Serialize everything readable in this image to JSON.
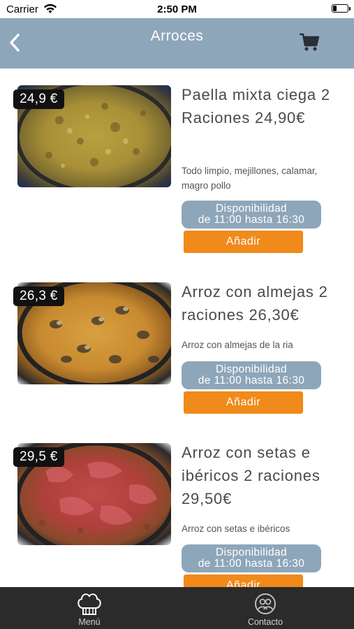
{
  "status_bar": {
    "carrier": "Carrier",
    "time": "2:50 PM"
  },
  "nav": {
    "title": "Arroces",
    "back_icon": "chevron-left-icon",
    "cart_icon": "shopping-cart-icon"
  },
  "items": [
    {
      "price_tag": "24,9 €",
      "name": "Paella mixta ciega 2 Raciones 24,90€",
      "description": "Todo limpio, mejillones, calamar, magro pollo",
      "availability_line1": "Disponibilidad",
      "availability_line2": "de 11:00 hasta 16:30",
      "add_label": "Añadir"
    },
    {
      "price_tag": "26,3 €",
      "name": "Arroz con almejas 2 raciones 26,30€",
      "description": "Arroz con almejas de la ria",
      "availability_line1": "Disponibilidad",
      "availability_line2": "de 11:00 hasta 16:30",
      "add_label": "Añadir"
    },
    {
      "price_tag": "29,5 €",
      "name": "Arroz con setas e ibéricos 2 raciones 29,50€",
      "description": "Arroz con setas e ibéricos",
      "availability_line1": "Disponibilidad",
      "availability_line2": "de 11:00 hasta 16:30",
      "add_label": "Añadir"
    }
  ],
  "tabbar": {
    "menu_label": "Menú",
    "contact_label": "Contacto"
  },
  "colors": {
    "nav_background": "#8ea6ba",
    "add_button": "#f08a1a",
    "tabbar": "#2b2b2b"
  }
}
